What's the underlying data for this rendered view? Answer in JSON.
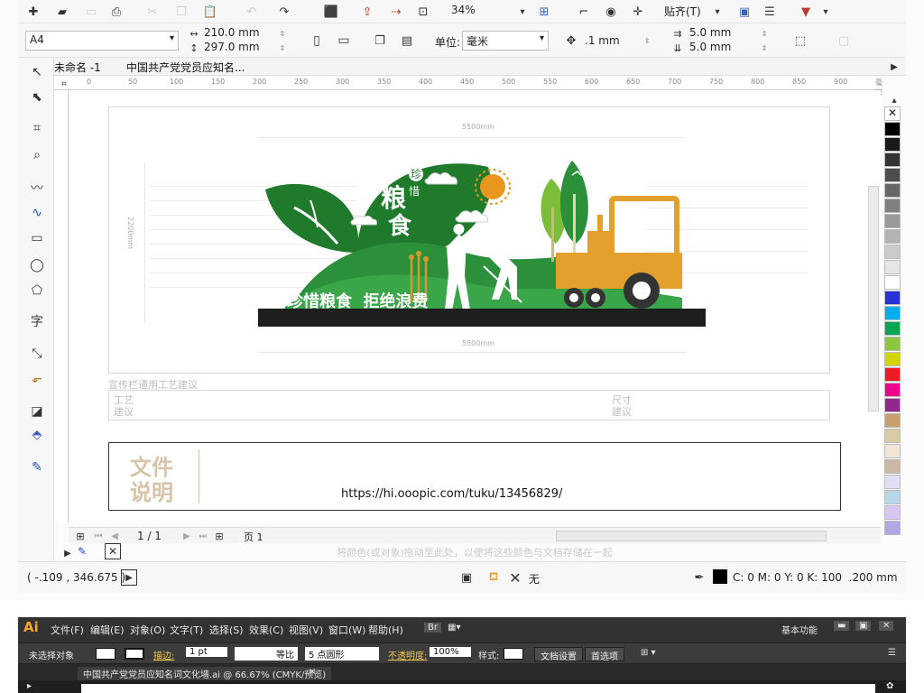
{
  "corel": {
    "page_size": "A4",
    "width": "210.0 mm",
    "height": "297.0 mm",
    "zoom": "34%",
    "snap_label": "贴齐(T)",
    "unit_label": "单位:",
    "unit_value": "毫米",
    "nudge": ".1 mm",
    "dup_x": "5.0 mm",
    "dup_y": "5.0 mm",
    "tabs": [
      "未命名 -1",
      "中国共产党党员应知名..."
    ],
    "ruler_ticks": [
      "0",
      "50",
      "100",
      "150",
      "200",
      "250",
      "300",
      "350",
      "400",
      "450",
      "500",
      "550",
      "600",
      "650",
      "700",
      "750",
      "800",
      "850",
      "900",
      "毫米"
    ],
    "page_nav": "1 / 1",
    "page_tab": "页 1",
    "hint": "将颜色(或对象)拖动至此处，以便将这些颜色与文档存储在一起",
    "coords": "( -.109 , 346.675 )",
    "fill_none": "无",
    "outline": "C: 0 M: 0 Y: 0 K: 100  .200 mm",
    "palette": [
      "#000000",
      "#1a1a1a",
      "#333333",
      "#4d4d4d",
      "#666666",
      "#808080",
      "#999999",
      "#b3b3b3",
      "#cccccc",
      "#e6e6e6",
      "#ffffff",
      "#2833d6",
      "#00aeef",
      "#00a651",
      "#8dc63f",
      "#d4d400",
      "#ed1c24",
      "#ec008c",
      "#92278f",
      "#c7a06a",
      "#d9cba3",
      "#f1e4d8",
      "#c9b8a6",
      "#e1dff4",
      "#b6d7e8",
      "#d7c7f2",
      "#b4a6e6"
    ]
  },
  "design": {
    "dim_top": "5500mm",
    "dim_bottom": "5500mm",
    "dim_side": "2200mm",
    "slogan": "珍惜粮食  拒绝浪费",
    "big_char_1": "粮",
    "big_char_2": "食",
    "small_char_1": "珍",
    "small_char_2": "惜",
    "section_title": "宣传栏通用工艺建议",
    "craft_label": "工艺\n建议",
    "size_label": "尺寸\n建议",
    "file_label_1": "文件",
    "file_label_2": "说明",
    "url": "https://hi.ooopic.com/tuku/13456829/"
  },
  "ai": {
    "logo": "Ai",
    "menu": [
      "文件(F)",
      "编辑(E)",
      "对象(O)",
      "文字(T)",
      "选择(S)",
      "效果(C)",
      "视图(V)",
      "窗口(W)",
      "帮助(H)"
    ],
    "workspace": "基本功能",
    "no_selection": "未选择对象",
    "stroke_label": "描边:",
    "stroke_value": "1 pt",
    "equal_ratio": "等比",
    "brush": "5 点圆形",
    "opacity_label": "不透明度:",
    "opacity_value": "100%",
    "style_label": "样式:",
    "doc_settings": "文档设置",
    "preferences": "首选项",
    "doc_title": "中国共产党党员应知名词文化墙.ai @ 66.67% (CMYK/预览)",
    "close": "×"
  }
}
